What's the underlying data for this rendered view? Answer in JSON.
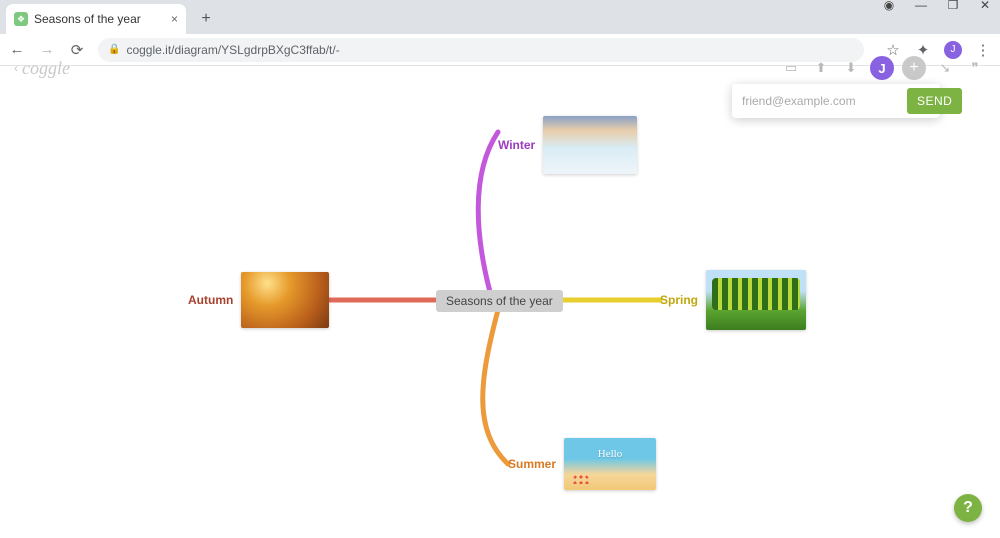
{
  "browser": {
    "tab_title": "Seasons of the year",
    "url": "coggle.it/diagram/YSLgdrpBXgC3ffab/t/-",
    "avatar_initial": "J"
  },
  "app": {
    "brand": "coggle"
  },
  "share": {
    "placeholder": "friend@example.com",
    "send_label": "SEND"
  },
  "mindmap": {
    "center": "Seasons of the year",
    "branches": {
      "winter": {
        "label": "Winter",
        "color": "#c458dd"
      },
      "spring": {
        "label": "Spring",
        "color": "#e6cf2f"
      },
      "summer": {
        "label": "Summer",
        "color": "#ec9a3b"
      },
      "autumn": {
        "label": "Autumn",
        "color": "#e06a5a"
      }
    }
  },
  "help": {
    "label": "?"
  }
}
